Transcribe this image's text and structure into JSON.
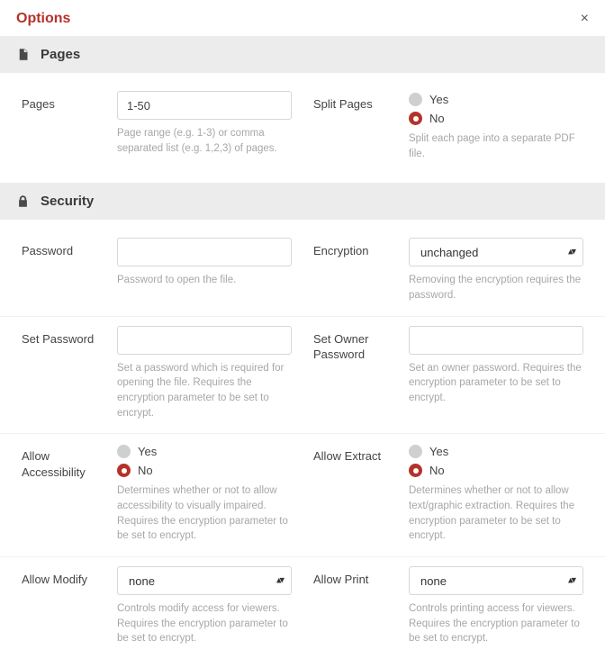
{
  "dialog": {
    "title": "Options",
    "close_icon": "×"
  },
  "sections": {
    "pages": {
      "title": "Pages"
    },
    "security": {
      "title": "Security"
    }
  },
  "fields": {
    "pages": {
      "label": "Pages",
      "value": "1-50",
      "hint": "Page range (e.g. 1-3) or comma separated list (e.g. 1,2,3) of pages."
    },
    "split_pages": {
      "label": "Split Pages",
      "options": {
        "yes": "Yes",
        "no": "No"
      },
      "value": "no",
      "hint": "Split each page into a separate PDF file."
    },
    "password": {
      "label": "Password",
      "value": "",
      "hint": "Password to open the file."
    },
    "encryption": {
      "label": "Encryption",
      "value": "unchanged",
      "hint": "Removing the encryption requires the password."
    },
    "set_password": {
      "label": "Set Password",
      "value": "",
      "hint": "Set a password which is required for opening the file. Requires the encryption parameter to be set to encrypt."
    },
    "set_owner_password": {
      "label": "Set Owner Password",
      "value": "",
      "hint": "Set an owner password. Requires the encryption parameter to be set to encrypt."
    },
    "allow_accessibility": {
      "label": "Allow Accessibility",
      "options": {
        "yes": "Yes",
        "no": "No"
      },
      "value": "no",
      "hint": "Determines whether or not to allow accessibility to visually impaired. Requires the encryption parameter to be set to encrypt."
    },
    "allow_extract": {
      "label": "Allow Extract",
      "options": {
        "yes": "Yes",
        "no": "No"
      },
      "value": "no",
      "hint": "Determines whether or not to allow text/graphic extraction. Requires the encryption parameter to be set to encrypt."
    },
    "allow_modify": {
      "label": "Allow Modify",
      "value": "none",
      "hint": "Controls modify access for viewers. Requires the encryption parameter to be set to encrypt."
    },
    "allow_print": {
      "label": "Allow Print",
      "value": "none",
      "hint": "Controls printing access for viewers. Requires the encryption parameter to be set to encrypt."
    }
  }
}
